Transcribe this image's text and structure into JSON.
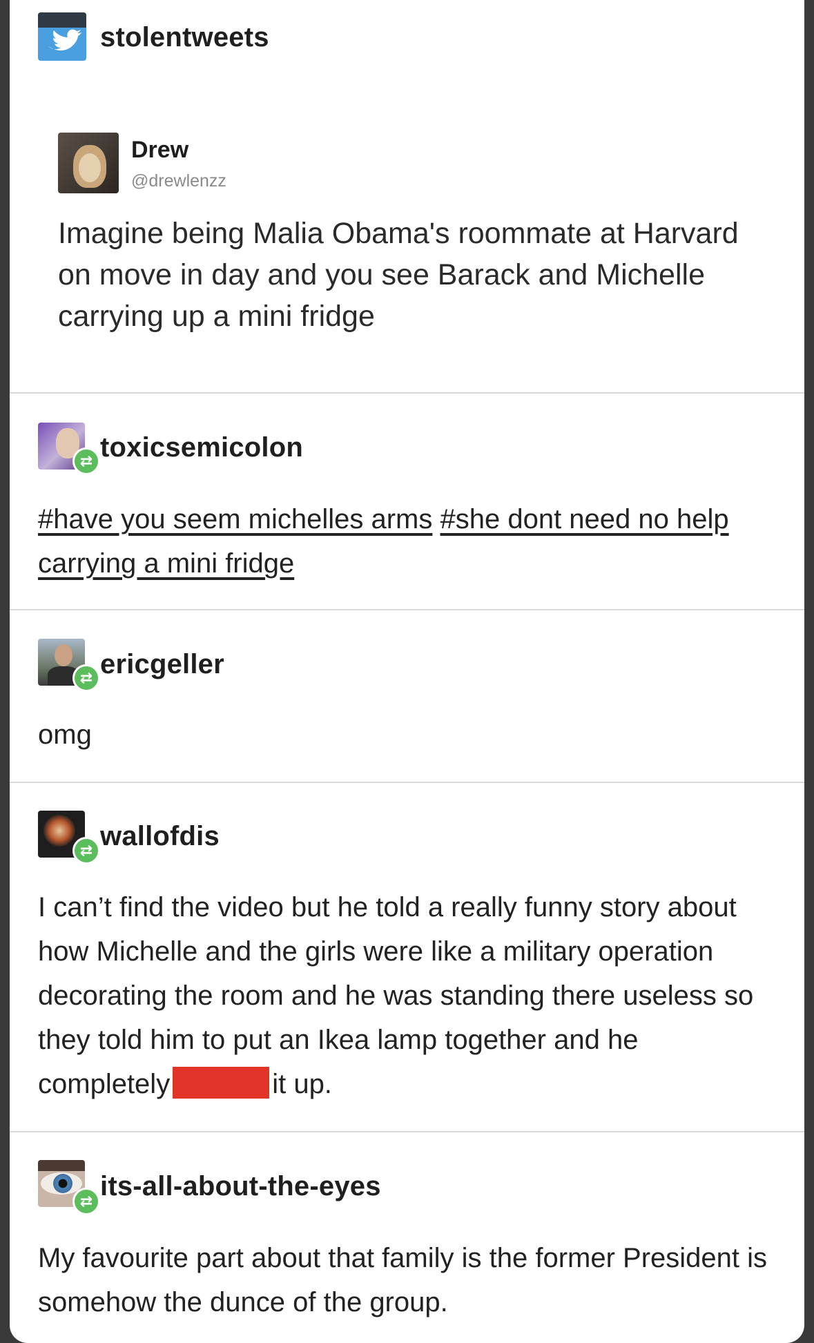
{
  "original_post": {
    "username": "stolentweets",
    "icon": "twitter-bird-icon",
    "tweet": {
      "name": "Drew",
      "handle": "@drewlenzz",
      "text": "Imagine being Malia Obama's roommate at Harvard on move in day and you see Barack and Michelle carrying up a mini fridge"
    }
  },
  "reblogs": [
    {
      "username": "toxicsemicolon",
      "tags": [
        "#have you seem michelles arms",
        "#she dont need no help carrying a mini fridge"
      ]
    },
    {
      "username": "ericgeller",
      "text": "omg"
    },
    {
      "username": "wallofdis",
      "text_before": "I can’t find the video but he told a really funny story about how Michelle and the girls were like a military operation decorating the room and he was standing there useless so they told him to put an Ikea lamp together and he completely",
      "text_after": "it up."
    },
    {
      "username": "its-all-about-the-eyes",
      "text": "My favourite part about that family is the former President is somehow the dunce of the group."
    }
  ],
  "colors": {
    "reblog_badge": "#5bbd5b",
    "redaction": "#e3342a",
    "twitter_blue": "#4a9fe0"
  }
}
